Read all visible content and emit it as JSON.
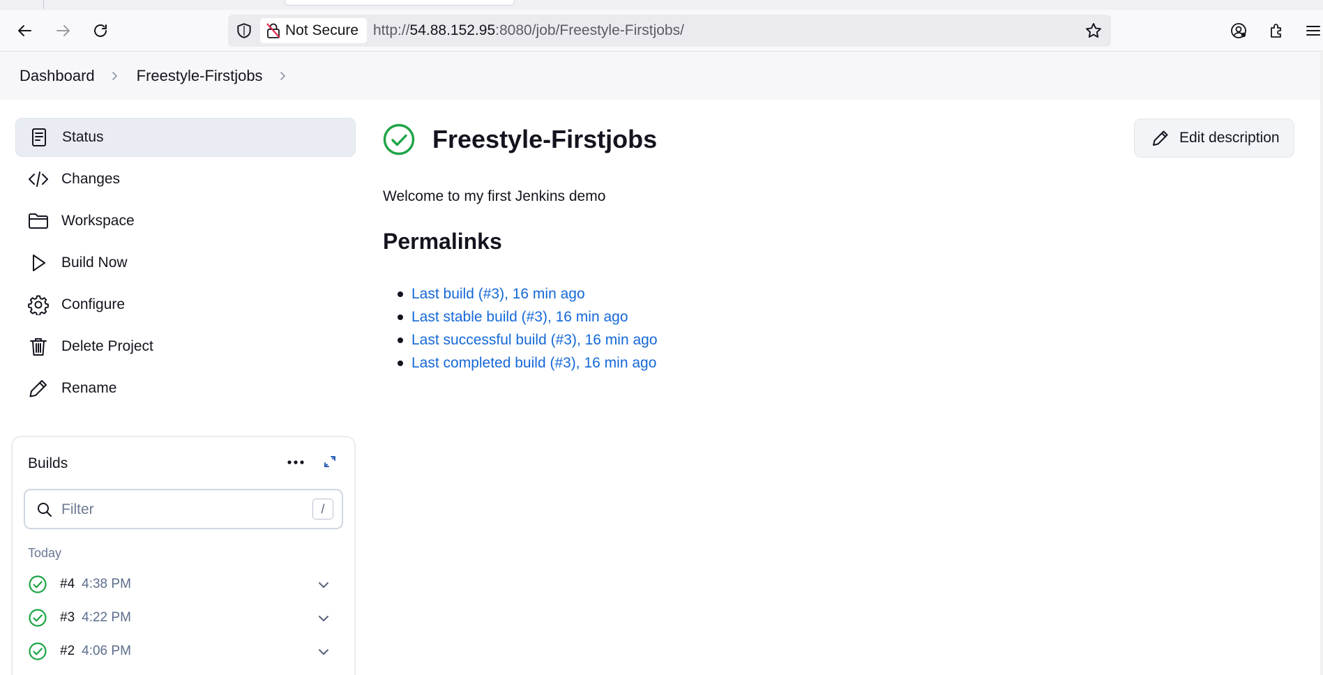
{
  "browser": {
    "security_label": "Not Secure",
    "url_prefix": "http://",
    "url_host": "54.88.152.95",
    "url_rest": ":8080/job/Freestyle-Firstjobs/"
  },
  "breadcrumb": {
    "items": [
      "Dashboard",
      "Freestyle-Firstjobs"
    ]
  },
  "sidebar": {
    "tasks": [
      {
        "label": "Status",
        "icon": "status-icon"
      },
      {
        "label": "Changes",
        "icon": "code-icon"
      },
      {
        "label": "Workspace",
        "icon": "folder-icon"
      },
      {
        "label": "Build Now",
        "icon": "play-icon"
      },
      {
        "label": "Configure",
        "icon": "gear-icon"
      },
      {
        "label": "Delete Project",
        "icon": "trash-icon"
      },
      {
        "label": "Rename",
        "icon": "pencil-icon"
      }
    ]
  },
  "builds": {
    "title": "Builds",
    "filter_placeholder": "Filter",
    "filter_shortcut": "/",
    "day_label": "Today",
    "rows": [
      {
        "number": "#4",
        "time": "4:38 PM"
      },
      {
        "number": "#3",
        "time": "4:22 PM"
      },
      {
        "number": "#2",
        "time": "4:06 PM"
      }
    ]
  },
  "job": {
    "title": "Freestyle-Firstjobs",
    "edit_description_label": "Edit description",
    "description": "Welcome to my first Jenkins demo",
    "permalinks_heading": "Permalinks",
    "permalinks": [
      "Last build (#3), 16 min ago",
      "Last stable build (#3), 16 min ago",
      "Last successful build (#3), 16 min ago",
      "Last completed build (#3), 16 min ago"
    ]
  },
  "colors": {
    "success": "#1ea446",
    "link": "#1468d8",
    "active_task_bg": "#e9edf3"
  }
}
